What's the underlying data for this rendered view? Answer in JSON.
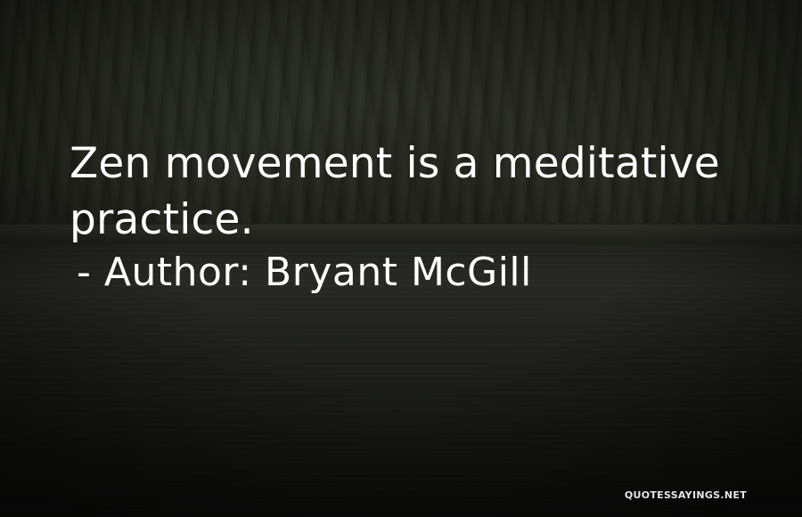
{
  "quote": {
    "text": "Zen movement is a meditative practice.",
    "attribution": "- Author: Bryant McGill"
  },
  "watermark": {
    "text": "QUOTESSAYINGS.NET"
  },
  "colors": {
    "text": "#ffffff",
    "background": "#23251d"
  }
}
